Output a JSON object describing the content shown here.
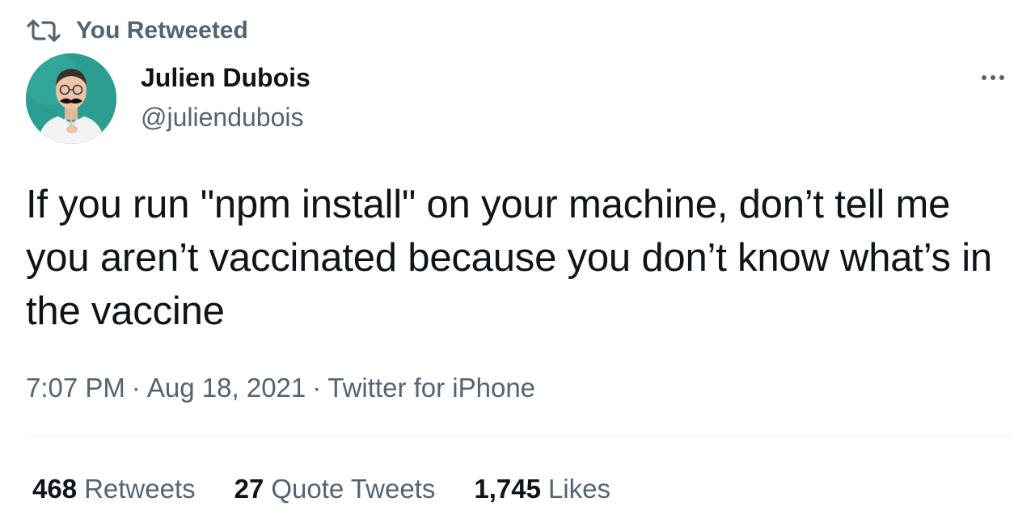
{
  "social_context": {
    "label": "You Retweeted",
    "icon": "retweet-icon"
  },
  "author": {
    "name": "Julien Dubois",
    "handle": "@juliendubois",
    "avatar_icon": "avatar-photo"
  },
  "more_icon": "more-options-icon",
  "tweet": {
    "text": "If you run \"npm install\" on your machine, don’t tell me you aren’t vaccinated because you don’t know what’s in the vaccine"
  },
  "meta": {
    "time": "7:07 PM",
    "separator": "·",
    "date": "Aug 18, 2021",
    "source": "Twitter for iPhone"
  },
  "stats": {
    "retweets": {
      "count": "468",
      "label": "Retweets"
    },
    "quote_tweets": {
      "count": "27",
      "label": "Quote Tweets"
    },
    "likes": {
      "count": "1,745",
      "label": "Likes"
    }
  },
  "colors": {
    "primary_text": "#0f1419",
    "secondary_text": "#536471",
    "divider": "#eff3f4",
    "background": "#ffffff"
  }
}
